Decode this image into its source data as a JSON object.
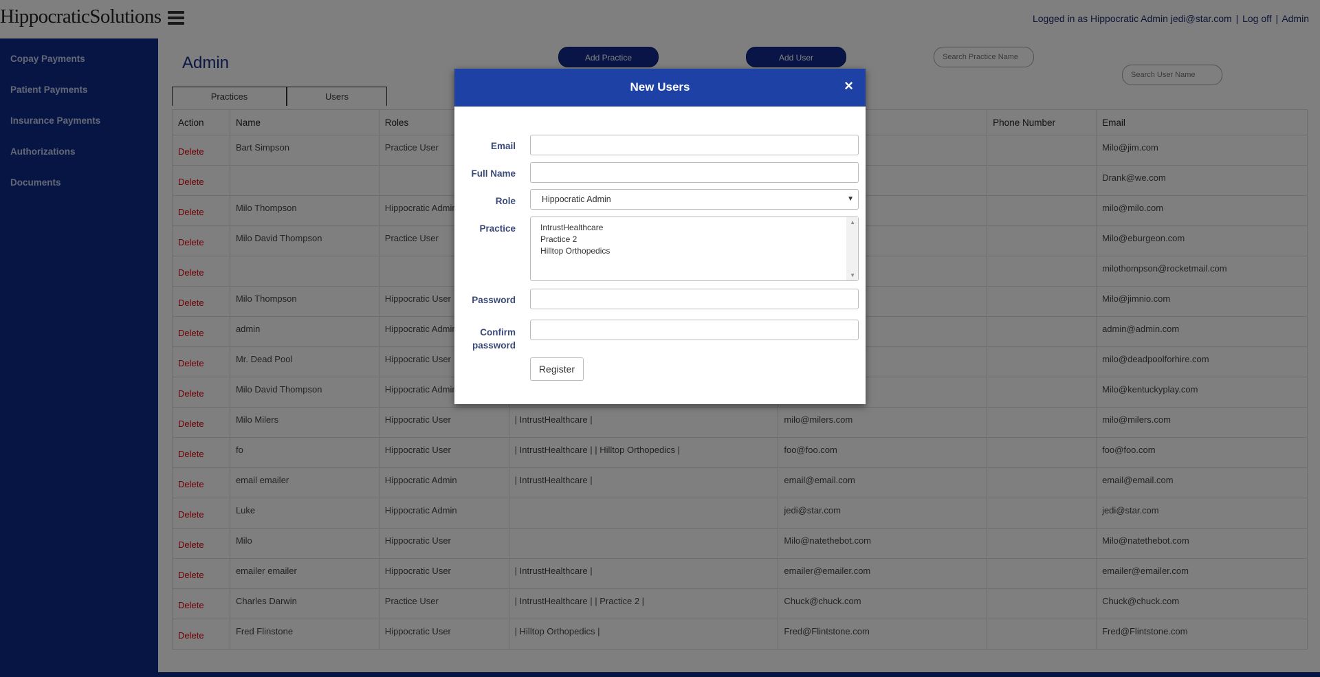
{
  "header": {
    "logo_text": "HippocraticSolutions",
    "logged_in_text": "Logged in as Hippocratic Admin jedi@star.com",
    "logoff_label": "Log off",
    "admin_label": "Admin"
  },
  "sidebar": {
    "items": [
      {
        "label": "Copay Payments"
      },
      {
        "label": "Patient Payments"
      },
      {
        "label": "Insurance Payments"
      },
      {
        "label": "Authorizations"
      },
      {
        "label": "Documents"
      }
    ]
  },
  "main": {
    "title": "Admin",
    "add_practice_label": "Add Practice",
    "add_user_label": "Add User",
    "search_practice_placeholder": "Search Practice Name",
    "search_user_placeholder": "Search User Name",
    "tabs": [
      {
        "label": "Practices"
      },
      {
        "label": "Users"
      }
    ]
  },
  "table": {
    "headers": [
      "Action",
      "Name",
      "Roles",
      "",
      "",
      "Phone Number",
      "Email"
    ],
    "delete_label": "Delete",
    "rows": [
      {
        "name": "Bart Simpson",
        "role": "Practice User",
        "practices": "",
        "username": "",
        "phone": "",
        "email": "Milo@jim.com"
      },
      {
        "name": "",
        "role": "",
        "practices": "",
        "username": "",
        "phone": "",
        "email": "Drank@we.com"
      },
      {
        "name": "Milo Thompson",
        "role": "Hippocratic Admin",
        "practices": "",
        "username": "",
        "phone": "",
        "email": "milo@milo.com"
      },
      {
        "name": "Milo David Thompson",
        "role": "Practice User",
        "practices": "",
        "username": "",
        "phone": "",
        "email": "Milo@eburgeon.com"
      },
      {
        "name": "",
        "role": "",
        "practices": "",
        "username": "",
        "phone": "",
        "email": "milothompson@rocketmail.com"
      },
      {
        "name": "Milo Thompson",
        "role": "Hippocratic User",
        "practices": "",
        "username": "",
        "phone": "",
        "email": "Milo@jimnio.com"
      },
      {
        "name": "admin",
        "role": "Hippocratic Admin",
        "practices": "",
        "username": "",
        "phone": "",
        "email": "admin@admin.com"
      },
      {
        "name": "Mr. Dead Pool",
        "role": "Hippocratic User",
        "practices": "",
        "username": "",
        "phone": "",
        "email": "milo@deadpoolforhire.com"
      },
      {
        "name": "Milo David Thompson",
        "role": "Hippocratic Admin",
        "practices": "",
        "username": "",
        "phone": "",
        "email": "Milo@kentuckyplay.com"
      },
      {
        "name": "Milo Milers",
        "role": "Hippocratic User",
        "practices": "| IntrustHealthcare |",
        "username": "milo@milers.com",
        "phone": "",
        "email": "milo@milers.com"
      },
      {
        "name": "fo",
        "role": "Hippocratic User",
        "practices": "| IntrustHealthcare | | Hilltop Orthopedics |",
        "username": "foo@foo.com",
        "phone": "",
        "email": "foo@foo.com"
      },
      {
        "name": "email emailer",
        "role": "Hippocratic Admin",
        "practices": "| IntrustHealthcare |",
        "username": "email@email.com",
        "phone": "",
        "email": "email@email.com"
      },
      {
        "name": "Luke",
        "role": "Hippocratic Admin",
        "practices": "",
        "username": "jedi@star.com",
        "phone": "",
        "email": "jedi@star.com"
      },
      {
        "name": "Milo",
        "role": "Hippocratic User",
        "practices": "",
        "username": "Milo@natethebot.com",
        "phone": "",
        "email": "Milo@natethebot.com"
      },
      {
        "name": "emailer emailer",
        "role": "Hippocratic User",
        "practices": "| IntrustHealthcare |",
        "username": "emailer@emailer.com",
        "phone": "",
        "email": "emailer@emailer.com"
      },
      {
        "name": "Charles Darwin",
        "role": "Practice User",
        "practices": "| IntrustHealthcare | | Practice 2 |",
        "username": "Chuck@chuck.com",
        "phone": "",
        "email": "Chuck@chuck.com"
      },
      {
        "name": "Fred Flinstone",
        "role": "Hippocratic User",
        "practices": "| Hilltop Orthopedics |",
        "username": "Fred@Flintstone.com",
        "phone": "",
        "email": "Fred@Flintstone.com"
      }
    ]
  },
  "modal": {
    "title": "New Users",
    "close_glyph": "×",
    "email_label": "Email",
    "fullname_label": "Full Name",
    "role_label": "Role",
    "role_value": "Hippocratic Admin",
    "practice_label": "Practice",
    "practice_options": [
      "IntrustHealthcare",
      "Practice 2",
      "Hilltop Orthopedics"
    ],
    "password_label": "Password",
    "confirm_label_line1": "Confirm",
    "confirm_label_line2": "password",
    "register_label": "Register"
  }
}
